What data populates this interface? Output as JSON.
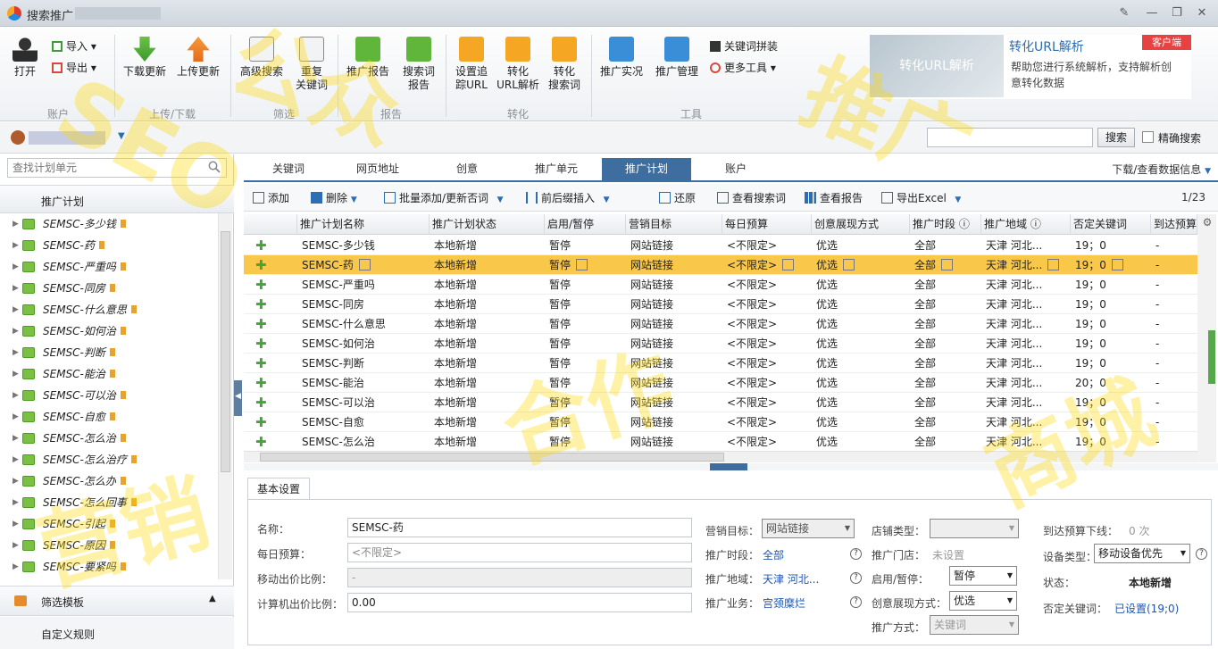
{
  "title": "搜索推广",
  "ribbon": {
    "open": "打开",
    "import": "导入",
    "export": "导出",
    "download_update": "下载更新",
    "upload_update": "上传更新",
    "advanced_search": "高级搜索",
    "reset_keyword_1": "重复",
    "reset_keyword_2": "关键词",
    "promo_report": "推广报告",
    "search_term_report_1": "搜索词",
    "search_term_report_2": "报告",
    "tracking_url_1": "设置追",
    "tracking_url_2": "踪URL",
    "convert_url_1": "转化",
    "convert_url_2": "URL解析",
    "convert_search_1": "转化",
    "convert_search_2": "搜索词",
    "promo_live": "推广实况",
    "promo_manage": "推广管理",
    "keyword_merge": "关键词拼装",
    "more_tools": "更多工具",
    "groups": {
      "account": "账户",
      "updown": "上传/下载",
      "filter": "筛选",
      "report": "报告",
      "convert": "转化",
      "tools": "工具"
    },
    "promo": {
      "image_text": "转化URL解析",
      "title": "转化URL解析",
      "desc": "帮助您进行系统解析，支持解析创意转化数据",
      "badge": "客户端"
    }
  },
  "userbar": {
    "search_button": "搜索",
    "exact_label": "精确搜索"
  },
  "left": {
    "search_placeholder": "查找计划单元",
    "header": "推广计划",
    "items": [
      "SEMSC-多少钱",
      "SEMSC-药",
      "SEMSC-严重吗",
      "SEMSC-同房",
      "SEMSC-什么意思",
      "SEMSC-如何治",
      "SEMSC-判断",
      "SEMSC-能治",
      "SEMSC-可以治",
      "SEMSC-自愈",
      "SEMSC-怎么治",
      "SEMSC-怎么治疗",
      "SEMSC-怎么办",
      "SEMSC-怎么回事",
      "SEMSC-引起",
      "SEMSC-原因",
      "SEMSC-要紧吗"
    ],
    "filter_template": "筛选模板",
    "custom_rule": "自定义规则"
  },
  "tabs": [
    "关键词",
    "网页地址",
    "创意",
    "推广单元",
    "推广计划",
    "账户"
  ],
  "active_tab": "推广计划",
  "download_info": "下载/查看数据信息",
  "toolbar": {
    "add": "添加",
    "delete": "删除",
    "batch_add": "批量添加/更新否词",
    "insert": "前后缀插入",
    "restore": "还原",
    "view_search_terms": "查看搜索词",
    "view_report": "查看报告",
    "export_excel": "导出Excel",
    "pager": "1/23"
  },
  "grid": {
    "headers": [
      "推广计划名称",
      "推广计划状态",
      "启用/暂停",
      "营销目标",
      "每日预算",
      "创意展现方式",
      "推广时段",
      "推广地域",
      "否定关键词",
      "到达预算"
    ],
    "rows": [
      [
        "SEMSC-多少钱",
        "本地新增",
        "暂停",
        "网站链接",
        "<不限定>",
        "优选",
        "全部",
        "天津 河北...",
        "19；0",
        "-"
      ],
      [
        "SEMSC-药",
        "本地新增",
        "暂停",
        "网站链接",
        "<不限定>",
        "优选",
        "全部",
        "天津 河北...",
        "19；0",
        "-"
      ],
      [
        "SEMSC-严重吗",
        "本地新增",
        "暂停",
        "网站链接",
        "<不限定>",
        "优选",
        "全部",
        "天津 河北...",
        "19；0",
        "-"
      ],
      [
        "SEMSC-同房",
        "本地新增",
        "暂停",
        "网站链接",
        "<不限定>",
        "优选",
        "全部",
        "天津 河北...",
        "19；0",
        "-"
      ],
      [
        "SEMSC-什么意思",
        "本地新增",
        "暂停",
        "网站链接",
        "<不限定>",
        "优选",
        "全部",
        "天津 河北...",
        "19；0",
        "-"
      ],
      [
        "SEMSC-如何治",
        "本地新增",
        "暂停",
        "网站链接",
        "<不限定>",
        "优选",
        "全部",
        "天津 河北...",
        "19；0",
        "-"
      ],
      [
        "SEMSC-判断",
        "本地新增",
        "暂停",
        "网站链接",
        "<不限定>",
        "优选",
        "全部",
        "天津 河北...",
        "19；0",
        "-"
      ],
      [
        "SEMSC-能治",
        "本地新增",
        "暂停",
        "网站链接",
        "<不限定>",
        "优选",
        "全部",
        "天津 河北...",
        "20；0",
        "-"
      ],
      [
        "SEMSC-可以治",
        "本地新增",
        "暂停",
        "网站链接",
        "<不限定>",
        "优选",
        "全部",
        "天津 河北...",
        "19；0",
        "-"
      ],
      [
        "SEMSC-自愈",
        "本地新增",
        "暂停",
        "网站链接",
        "<不限定>",
        "优选",
        "全部",
        "天津 河北...",
        "19；0",
        "-"
      ],
      [
        "SEMSC-怎么治",
        "本地新增",
        "暂停",
        "网站链接",
        "<不限定>",
        "优选",
        "全部",
        "天津 河北...",
        "19；0",
        "-"
      ]
    ],
    "selected_row": 1
  },
  "detail": {
    "tab": "基本设置",
    "name_label": "名称：",
    "name_value": "SEMSC-药",
    "budget_label": "每日预算：",
    "budget_value": "<不限定>",
    "mobile_ratio_label": "移动出价比例：",
    "mobile_ratio_value": "-",
    "pc_ratio_label": "计算机出价比例：",
    "pc_ratio_value": "0.00",
    "target_label": "营销目标：",
    "target_value": "网站链接",
    "time_label": "推广时段：",
    "time_value": "全部",
    "region_label": "推广地域：",
    "region_value": "天津 河北...",
    "business_label": "推广业务：",
    "business_value": "宫颈糜烂",
    "store_type_label": "店铺类型：",
    "store_label": "推广门店：",
    "store_value": "未设置",
    "status_label": "启用/暂停：",
    "status_value": "暂停",
    "creative_label": "创意展现方式：",
    "creative_value": "优选",
    "method_label": "推广方式：",
    "method_value": "关键词",
    "budget_reach_label": "到达预算下线：",
    "budget_reach_value": "0 次",
    "device_label": "设备类型：",
    "device_value": "移动设备优先",
    "state_label": "状态：",
    "state_value": "本地新增",
    "neg_label": "否定关键词：",
    "neg_value": "已设置(19;0)"
  },
  "colors": {
    "accent": "#3e6e9f",
    "selected_row": "#f9c74a",
    "link": "#1e55b3",
    "watermark": "#ffd700"
  }
}
